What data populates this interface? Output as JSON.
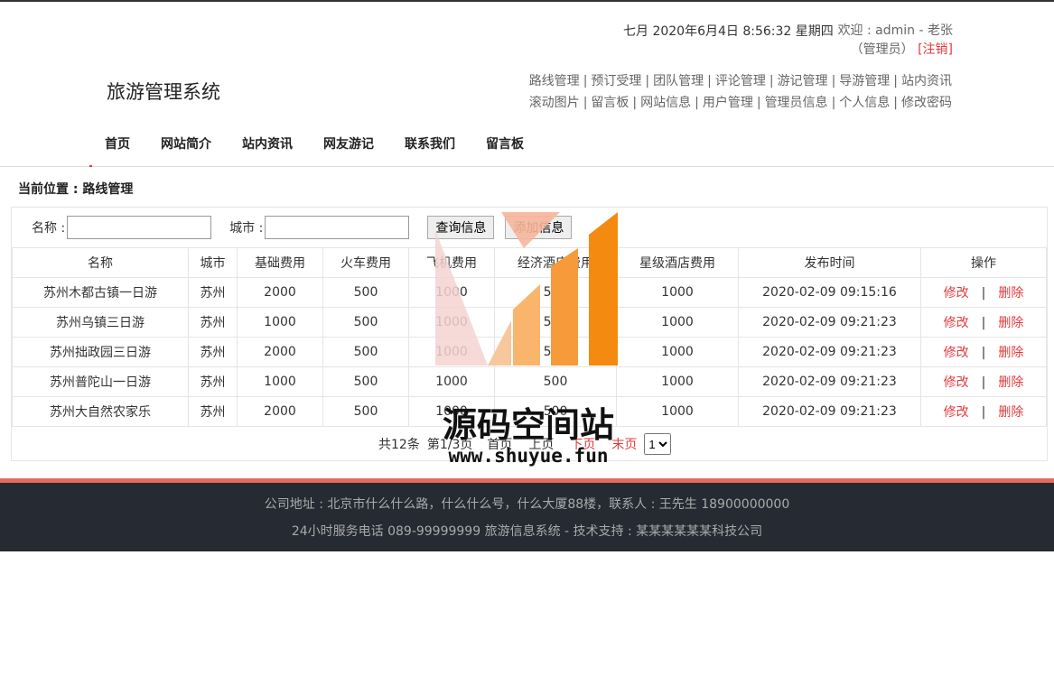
{
  "header": {
    "datetime": "七月 2020年6月4日 8:56:32 星期四",
    "welcome_prefix": "欢迎 : admin - 老张",
    "role": "（管理员）",
    "logout": "[注销]",
    "site_title": "旅游管理系统",
    "admin_links_row1": [
      "路线管理",
      "预订受理",
      "团队管理",
      "评论管理",
      "游记管理",
      "导游管理",
      "站内资讯"
    ],
    "admin_links_row2": [
      "滚动图片",
      "留言板",
      "网站信息",
      "用户管理",
      "管理员信息",
      "个人信息",
      "修改密码"
    ],
    "nav": [
      "首页",
      "网站简介",
      "站内资讯",
      "网友游记",
      "联系我们",
      "留言板"
    ]
  },
  "breadcrumb": "当前位置 : 路线管理",
  "search": {
    "name_label": "名称 :",
    "city_label": "城市 :",
    "query_button": "查询信息",
    "add_button": "添加信息"
  },
  "table": {
    "headers": [
      "名称",
      "城市",
      "基础费用",
      "火车费用",
      "飞机费用",
      "经济酒店费用",
      "星级酒店费用",
      "发布时间",
      "操作"
    ],
    "edit_label": "修改",
    "delete_label": "删除",
    "op_sep": "|",
    "rows": [
      [
        "苏州木都古镇一日游",
        "苏州",
        "2000",
        "500",
        "1000",
        "500",
        "1000",
        "2020-02-09 09:15:16"
      ],
      [
        "苏州乌镇三日游",
        "苏州",
        "1000",
        "500",
        "1000",
        "500",
        "1000",
        "2020-02-09 09:21:23"
      ],
      [
        "苏州拙政园三日游",
        "苏州",
        "2000",
        "500",
        "1000",
        "500",
        "1000",
        "2020-02-09 09:21:23"
      ],
      [
        "苏州普陀山一日游",
        "苏州",
        "1000",
        "500",
        "1000",
        "500",
        "1000",
        "2020-02-09 09:21:23"
      ],
      [
        "苏州大自然农家乐",
        "苏州",
        "2000",
        "500",
        "1000",
        "500",
        "1000",
        "2020-02-09 09:21:23"
      ]
    ]
  },
  "pager": {
    "total": "共12条",
    "page": "第1/3页",
    "first": "首页",
    "prev": "上页",
    "next": "下页",
    "last": "末页",
    "select_value": "1"
  },
  "footer": {
    "line1": "公司地址 : 北京市什么什么路，什么什么号，什么大厦88楼，联系人 : 王先生 18900000000",
    "line2": "24小时服务电话   089-99999999   旅游信息系统 - 技术支持 : 某某某某某某科技公司"
  },
  "watermark": {
    "text": "源码空间站",
    "url": "www.shuyue.fun"
  },
  "colors": {
    "accent": "#e4393c",
    "footer_bg": "#252a33",
    "footer_border": "#e9695e"
  }
}
